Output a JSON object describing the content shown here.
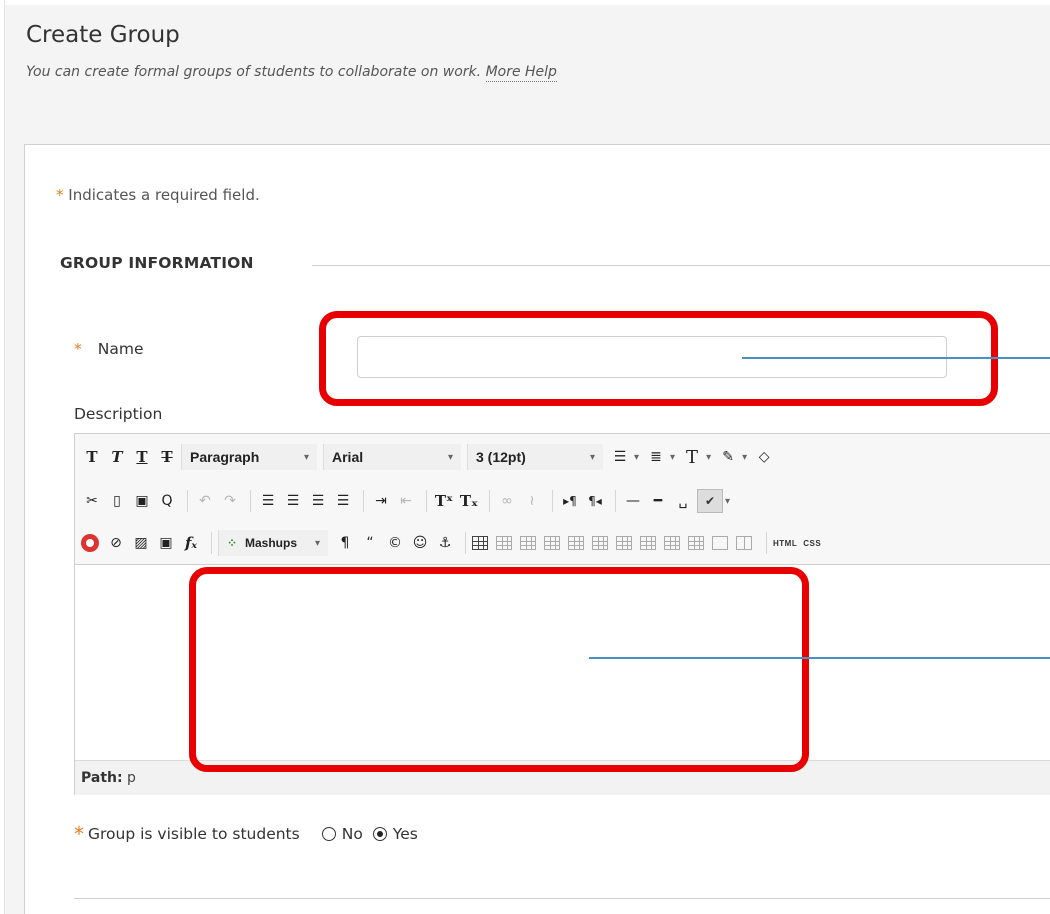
{
  "page": {
    "title": "Create Group",
    "subtitle": "You can create formal groups of students to collaborate on work.",
    "help_link": "More Help"
  },
  "form": {
    "required_star": "*",
    "required_note": " Indicates a required field.",
    "section_title": "GROUP INFORMATION",
    "name_label": "Name",
    "name_value": "",
    "description_label": "Description",
    "visibility_label": "Group is visible to students",
    "visibility_options": [
      "No",
      "Yes"
    ],
    "visibility_selected": "Yes"
  },
  "editor": {
    "format_select": "Paragraph",
    "font_select": "Arial",
    "size_select": "3 (12pt)",
    "mashups_label": "Mashups",
    "html_label": "HTML",
    "css_label": "CSS",
    "path_label": "Path:",
    "path_value": "p",
    "content": ""
  },
  "annotations": {
    "highlight_color": "#e80000",
    "callout_color": "#4a90c8"
  },
  "icons": [
    "bold-icon",
    "italic-icon",
    "underline-icon",
    "strikethrough-icon",
    "unordered-list-icon",
    "ordered-list-icon",
    "text-color-icon",
    "highlight-icon",
    "eraser-icon",
    "cut-icon",
    "copy-icon",
    "paste-icon",
    "find-icon",
    "undo-icon",
    "redo-icon",
    "align-left-icon",
    "align-center-icon",
    "align-right-icon",
    "justify-icon",
    "indent-icon",
    "outdent-icon",
    "superscript-icon",
    "clear-format-icon",
    "link-icon",
    "unlink-icon",
    "ltr-icon",
    "rtl-icon",
    "horizontal-rule-icon",
    "thick-rule-icon",
    "nonbreaking-space-icon",
    "spellcheck-icon",
    "youtube-icon",
    "attachment-icon",
    "image-icon",
    "media-icon",
    "math-icon",
    "mashups-icon",
    "paragraph-icon",
    "quote-icon",
    "copyright-icon",
    "emoticon-icon",
    "anchor-icon",
    "table-icon"
  ]
}
